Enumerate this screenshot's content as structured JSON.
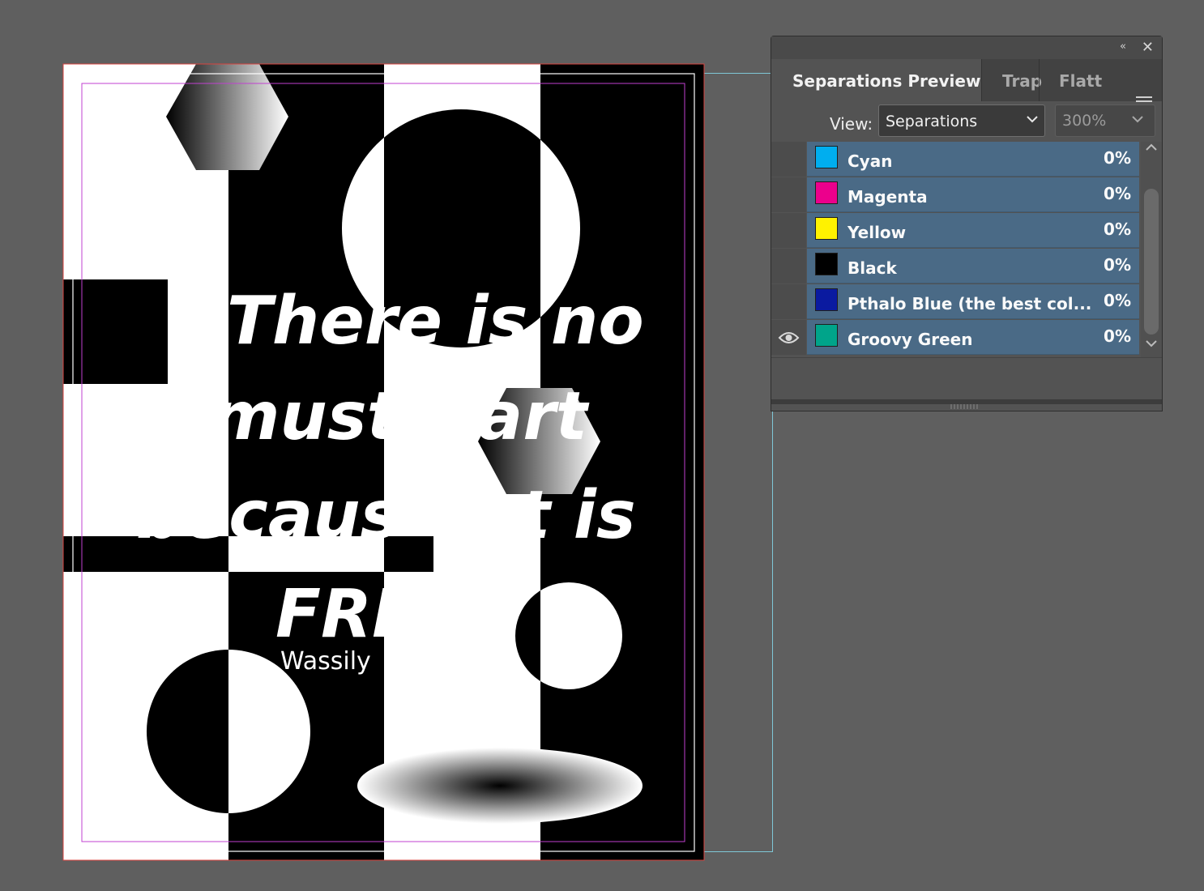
{
  "panel": {
    "tabs": [
      {
        "label": "Separations Preview"
      },
      {
        "label": "Trap"
      },
      {
        "label": "Flatt"
      }
    ],
    "view_label": "View:",
    "view_value": "Separations",
    "zoom_value": "300%",
    "inks": [
      {
        "name": "Cyan",
        "percent": "0%",
        "color": "#00aeef",
        "visible": false
      },
      {
        "name": "Magenta",
        "percent": "0%",
        "color": "#ec008c",
        "visible": false
      },
      {
        "name": "Yellow",
        "percent": "0%",
        "color": "#fff200",
        "visible": false
      },
      {
        "name": "Black",
        "percent": "0%",
        "color": "#000000",
        "visible": false
      },
      {
        "name": "Pthalo Blue (the best col...",
        "percent": "0%",
        "color": "#0a1aa0",
        "visible": false
      },
      {
        "name": "Groovy Green",
        "percent": "0%",
        "color": "#00a48a",
        "visible": true
      }
    ]
  },
  "document": {
    "quote_lines": [
      "There is no",
      "must",
      "art",
      "becaus",
      "t is",
      "FRE"
    ],
    "attribution": "Wassily"
  }
}
